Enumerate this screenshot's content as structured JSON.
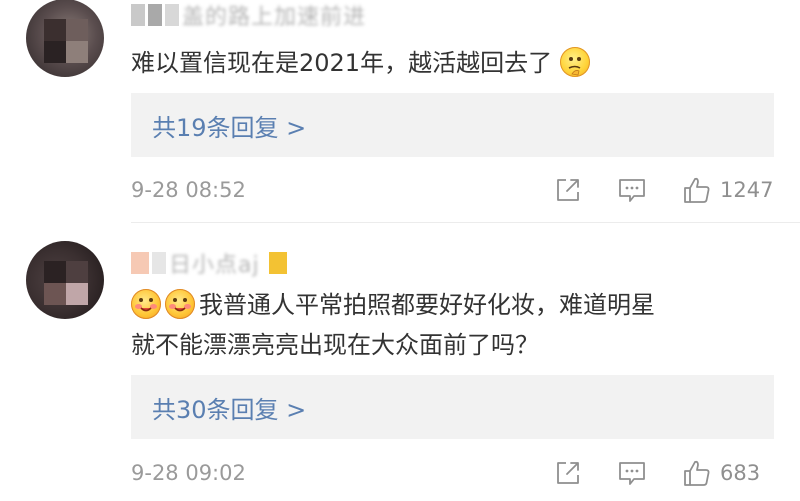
{
  "comments": [
    {
      "username": "盖的路上加速前进",
      "text": "难以置信现在是2021年，越活越回去了",
      "emojis": [
        "thinking-emoji"
      ],
      "replies_label": "共19条回复 >",
      "timestamp": "9-28 08:52",
      "likes": "1247"
    },
    {
      "username": "日小点aj",
      "text_line1": "我普通人平常拍照都要好好化妆，难道明星",
      "text_line2": "就不能漂漂亮亮出现在大众面前了吗？",
      "emojis": [
        "yum-emoji",
        "yum-emoji"
      ],
      "replies_label": "共30条回复 >",
      "timestamp": "9-28 09:02",
      "likes": "683"
    }
  ],
  "icons": {
    "share": "share-icon",
    "reply": "comment-icon",
    "like": "thumbs-up-icon"
  },
  "colors": {
    "link": "#5a7fb1",
    "text": "#333333",
    "meta": "#9a9a9a",
    "reply_bg": "#f2f2f2"
  }
}
